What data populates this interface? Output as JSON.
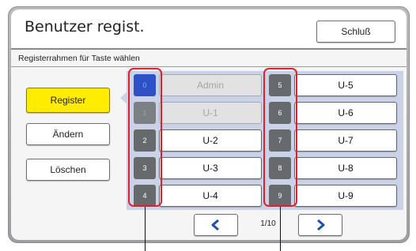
{
  "header": {
    "title": "Benutzer regist.",
    "close_label": "Schluß"
  },
  "subtitle": "Registerrahmen für Taste wählen",
  "side_buttons": [
    {
      "label": "Register",
      "active": true
    },
    {
      "label": "Ändern",
      "active": false
    },
    {
      "label": "Löschen",
      "active": false
    }
  ],
  "left_column": [
    {
      "num": "0",
      "name": "Admin",
      "state": "selected"
    },
    {
      "num": "1",
      "name": "U-1",
      "state": "dim"
    },
    {
      "num": "2",
      "name": "U-2",
      "state": "normal"
    },
    {
      "num": "3",
      "name": "U-3",
      "state": "normal"
    },
    {
      "num": "4",
      "name": "U-4",
      "state": "normal"
    }
  ],
  "right_column": [
    {
      "num": "5",
      "name": "U-5",
      "state": "normal"
    },
    {
      "num": "6",
      "name": "U-6",
      "state": "normal"
    },
    {
      "num": "7",
      "name": "U-7",
      "state": "normal"
    },
    {
      "num": "8",
      "name": "U-8",
      "state": "normal"
    },
    {
      "num": "9",
      "name": "U-9",
      "state": "normal"
    }
  ],
  "pagination": {
    "page": "1/10"
  },
  "colors": {
    "accent_yellow": "#ffec00",
    "selected_blue": "#2e51c8",
    "grid_bg": "#c9d2e6",
    "callout_red": "#e2202b",
    "nav_arrow": "#1f4fb5"
  },
  "icons": {
    "prev": "chevron-left-icon",
    "next": "chevron-right-icon"
  }
}
